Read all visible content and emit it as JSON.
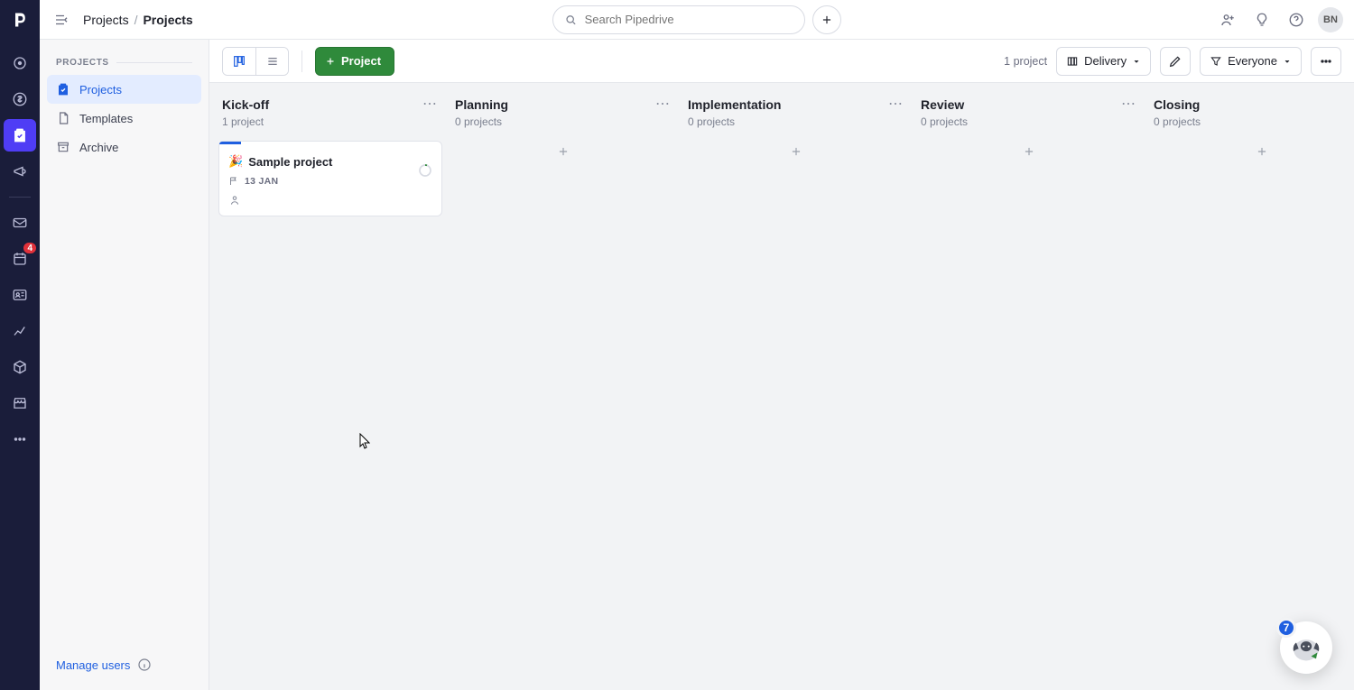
{
  "header": {
    "breadcrumb_root": "Projects",
    "breadcrumb_current": "Projects",
    "search_placeholder": "Search Pipedrive",
    "avatar_initials": "BN"
  },
  "nav_rail": {
    "badge_count": "4"
  },
  "secondary_sidebar": {
    "section_title": "PROJECTS",
    "items": [
      {
        "label": "Projects",
        "active": true
      },
      {
        "label": "Templates",
        "active": false
      },
      {
        "label": "Archive",
        "active": false
      }
    ],
    "manage_users_label": "Manage users"
  },
  "toolbar": {
    "new_project_label": "Project",
    "count_text": "1 project",
    "board_filter_label": "Delivery",
    "people_filter_label": "Everyone"
  },
  "board": {
    "columns": [
      {
        "title": "Kick-off",
        "subtitle": "1 project"
      },
      {
        "title": "Planning",
        "subtitle": "0 projects"
      },
      {
        "title": "Implementation",
        "subtitle": "0 projects"
      },
      {
        "title": "Review",
        "subtitle": "0 projects"
      },
      {
        "title": "Closing",
        "subtitle": "0 projects"
      }
    ],
    "card0": {
      "emoji": "🎉",
      "title": "Sample project",
      "date": "13 JAN"
    }
  },
  "help": {
    "count": "7"
  }
}
